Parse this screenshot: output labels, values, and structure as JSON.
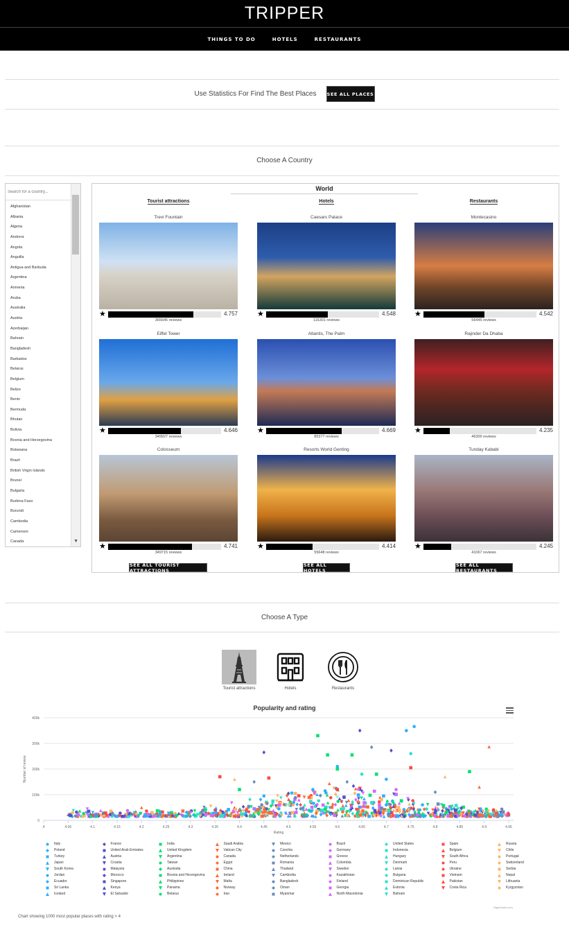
{
  "app": {
    "title": "TRIPPER"
  },
  "nav": {
    "items": [
      "THINGS TO DO",
      "HOTELS",
      "RESTAURANTS"
    ]
  },
  "stats": {
    "text": "Use Statistics For Find The Best Places",
    "button": "SEE ALL PLACES"
  },
  "choose_country": {
    "title": "Choose A Country"
  },
  "country_search": {
    "placeholder": "Search for a country..."
  },
  "countries": [
    "Afghanistan",
    "Albania",
    "Algeria",
    "Andorra",
    "Angola",
    "Anguilla",
    "Antigua and Barbuda",
    "Argentina",
    "Armenia",
    "Aruba",
    "Australia",
    "Austria",
    "Azerbaijan",
    "Bahrain",
    "Bangladesh",
    "Barbados",
    "Belarus",
    "Belgium",
    "Belize",
    "Benin",
    "Bermuda",
    "Bhutan",
    "Bolivia",
    "Bosnia and Herzegovina",
    "Botswana",
    "Brazil",
    "British Virgin Islands",
    "Brunei",
    "Bulgaria",
    "Burkina Faso",
    "Burundi",
    "Cambodia",
    "Cameroon",
    "Canada"
  ],
  "world": {
    "title": "World",
    "columns": [
      {
        "heading": "Tourist attractions",
        "button": "SEE ALL TOURIST ATTRACTIONS",
        "cards": [
          {
            "name": "Trevi Fountain",
            "reviews": "365645 reviews",
            "rating": "4.757",
            "fill": 0.757
          },
          {
            "name": "Eiffel Tower",
            "reviews": "349927 reviews",
            "rating": "4.646",
            "fill": 0.646
          },
          {
            "name": "Colosseum",
            "reviews": "349715 reviews",
            "rating": "4.741",
            "fill": 0.741
          }
        ]
      },
      {
        "heading": "Hotels",
        "button": "SEE ALL HOTELS",
        "cards": [
          {
            "name": "Caesars Palace",
            "reviews": "116301 reviews",
            "rating": "4.548",
            "fill": 0.548
          },
          {
            "name": "Atlantis, The Palm",
            "reviews": "85377 reviews",
            "rating": "4.669",
            "fill": 0.669
          },
          {
            "name": "Resorts World Genting",
            "reviews": "55648 reviews",
            "rating": "4.414",
            "fill": 0.414
          }
        ]
      },
      {
        "heading": "Restaurants",
        "button": "SEE ALL RESTAURANTS",
        "cards": [
          {
            "name": "Montecasino",
            "reviews": "56445 reviews",
            "rating": "4.542",
            "fill": 0.542
          },
          {
            "name": "Rajinder Da Dhaba",
            "reviews": "46300 reviews",
            "rating": "4.235",
            "fill": 0.235
          },
          {
            "name": "Tunday Kababi",
            "reviews": "41067 reviews",
            "rating": "4.245",
            "fill": 0.245
          }
        ]
      }
    ]
  },
  "choose_type": {
    "title": "Choose A Type",
    "types": [
      "Tourist attractions",
      "Hotels",
      "Restaurants"
    ]
  },
  "chart_data": {
    "type": "scatter",
    "title": "Popularity and rating",
    "xlabel": "Rating",
    "ylabel": "Number of review",
    "xlim": [
      4,
      4.96
    ],
    "ylim": [
      0,
      400000
    ],
    "x_ticks": [
      "4",
      "4.05",
      "4.1",
      "4.15",
      "4.2",
      "4.25",
      "4.3",
      "4.35",
      "4.4",
      "4.45",
      "4.5",
      "4.55",
      "4.6",
      "4.65",
      "4.7",
      "4.75",
      "4.8",
      "4.85",
      "4.9",
      "4.95"
    ],
    "y_ticks": [
      "0",
      "100k",
      "200k",
      "300k",
      "400k"
    ],
    "legend_position": "bottom",
    "series": [
      {
        "name": "Italy",
        "color": "#2caffe",
        "symbol": "circle",
        "points": [
          [
            4.757,
            365645
          ],
          [
            4.741,
            349715
          ],
          [
            4.6,
            210000
          ],
          [
            4.45,
            95000
          ],
          [
            4.55,
            120000
          ],
          [
            4.7,
            160000
          ]
        ]
      },
      {
        "name": "France",
        "color": "#544fc5",
        "symbol": "diamond",
        "points": [
          [
            4.646,
            349927
          ],
          [
            4.45,
            265000
          ],
          [
            4.71,
            272000
          ],
          [
            4.5,
            105000
          ]
        ]
      },
      {
        "name": "India",
        "color": "#00e272",
        "symbol": "square",
        "points": [
          [
            4.56,
            330000
          ],
          [
            4.58,
            255000
          ],
          [
            4.63,
            255000
          ],
          [
            4.6,
            200000
          ],
          [
            4.68,
            180000
          ],
          [
            4.4,
            120000
          ]
        ]
      },
      {
        "name": "Saudi Arabia",
        "color": "#fe6a35",
        "symbol": "triangle",
        "points": [
          [
            4.91,
            287000
          ],
          [
            4.2,
            50000
          ]
        ]
      },
      {
        "name": "United Kingdom",
        "color": "#6b8abc",
        "symbol": "diamond",
        "points": [
          [
            4.67,
            285000
          ],
          [
            4.43,
            150000
          ],
          [
            4.8,
            110000
          ]
        ]
      },
      {
        "name": "Mexico",
        "color": "#d568fb",
        "symbol": "triangle-down",
        "points": [
          [
            4.65,
            50000
          ],
          [
            4.3,
            30000
          ]
        ]
      },
      {
        "name": "Brazil",
        "color": "#2ee0ca",
        "symbol": "circle",
        "points": [
          [
            4.75,
            260000
          ],
          [
            4.65,
            180000
          ]
        ]
      },
      {
        "name": "United States",
        "color": "#fa4b42",
        "symbol": "square",
        "points": [
          [
            4.36,
            170000
          ],
          [
            4.46,
            165000
          ],
          [
            4.75,
            205000
          ],
          [
            4.6,
            120000
          ]
        ]
      },
      {
        "name": "Spain",
        "color": "#feb56a",
        "symbol": "triangle",
        "points": [
          [
            4.39,
            160000
          ],
          [
            4.82,
            170000
          ]
        ]
      },
      {
        "name": "Russia",
        "color": "#91e8e1",
        "symbol": "triangle-down",
        "points": [
          [
            4.6,
            90000
          ],
          [
            4.5,
            60000
          ]
        ]
      },
      {
        "name": "Poland",
        "color": "#2caffe",
        "symbol": "circle",
        "points": [
          [
            4.7,
            60000
          ]
        ]
      },
      {
        "name": "Chile",
        "color": "#544fc5",
        "symbol": "diamond",
        "points": [
          [
            4.8,
            40000
          ]
        ]
      },
      {
        "name": "Vatican City",
        "color": "#00e272",
        "symbol": "square",
        "points": [
          [
            4.87,
            190000
          ]
        ]
      },
      {
        "name": "Czechia",
        "color": "#fe6a35",
        "symbol": "triangle",
        "points": [
          [
            4.89,
            130000
          ]
        ]
      },
      {
        "name": "Germany",
        "color": "#6b8abc",
        "symbol": "diamond",
        "points": [
          [
            4.62,
            150000
          ]
        ]
      },
      {
        "name": "Indonesia",
        "color": "#d568fb",
        "symbol": "circle",
        "points": [
          [
            4.72,
            120000
          ]
        ]
      }
    ],
    "legend": [
      "Italy",
      "France",
      "India",
      "Saudi Arabia",
      "Mexico",
      "Brazil",
      "United States",
      "Spain",
      "Russia",
      "Poland",
      "United Arab Emirates",
      "United Kingdom",
      "Vatican City",
      "Czechia",
      "Germany",
      "Indonesia",
      "Belgium",
      "Chile",
      "Turkey",
      "Austria",
      "Argentina",
      "Canada",
      "Netherlands",
      "Greece",
      "Hungary",
      "South Africa",
      "Portugal",
      "Japan",
      "Croatia",
      "Taiwan",
      "Egypt",
      "Romania",
      "Colombia",
      "Denmark",
      "Peru",
      "Switzerland",
      "South Korea",
      "Malaysia",
      "Australia",
      "China",
      "Thailand",
      "Sweden",
      "Latvia",
      "Ukraine",
      "Serbia",
      "Jordan",
      "Morocco",
      "Bosnia and Herzegovina",
      "Ireland",
      "Cambodia",
      "Kazakhstan",
      "Bulgaria",
      "Vietnam",
      "Nepal",
      "Ecuador",
      "Singapore",
      "Philippines",
      "Malta",
      "Bangladesh",
      "Finland",
      "Dominican Republic",
      "Pakistan",
      "Lithuania",
      "Sri Lanka",
      "Kenya",
      "Panama",
      "Norway",
      "Oman",
      "Georgia",
      "Estonia",
      "Costa Rica",
      "Kyrgyzstan",
      "Iceland",
      "El Salvador",
      "Belarus",
      "Iran",
      "Myanmar",
      "North Macedonia",
      "Bahrain"
    ],
    "legend_colors": [
      "#2caffe",
      "#544fc5",
      "#00e272",
      "#fe6a35",
      "#6b8abc",
      "#d568fb",
      "#2ee0ca",
      "#fa4b42",
      "#feb56a"
    ],
    "legend_symbols": [
      "circle",
      "diamond",
      "square",
      "triangle",
      "triangle-down"
    ]
  },
  "footnote": "Chart showing 1000 most popular places with rating > 4",
  "credits": "Highcharts.com"
}
